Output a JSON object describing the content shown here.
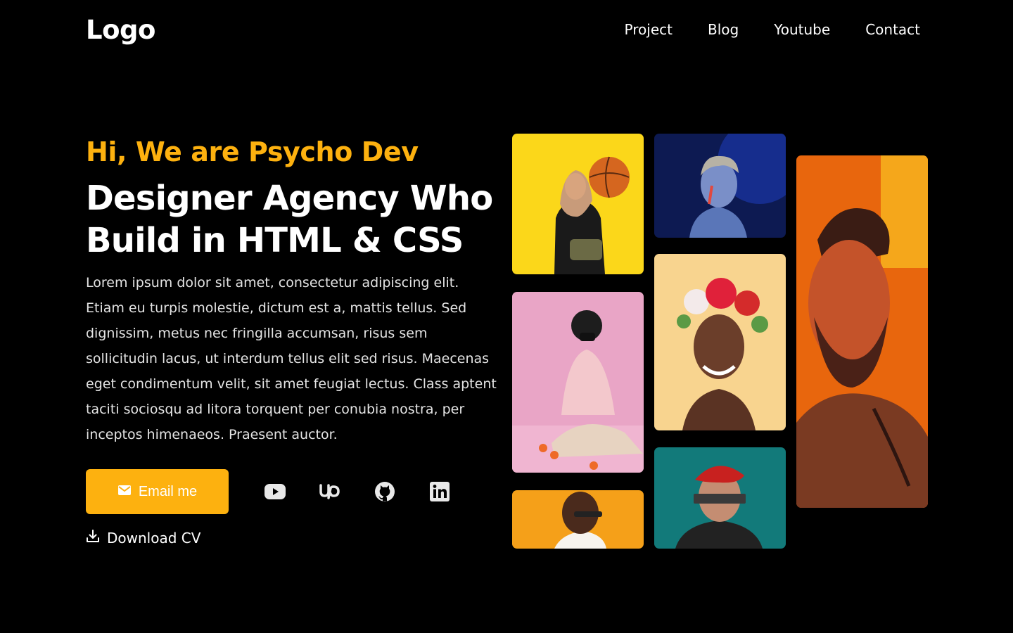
{
  "nav": {
    "logo": "Logo",
    "links": [
      "Project",
      "Blog",
      "Youtube",
      "Contact"
    ]
  },
  "hero": {
    "greeting": "Hi, We are Psycho Dev",
    "headline_line1": "Designer Agency Who",
    "headline_line2": "Build in HTML & CSS",
    "description": "Lorem ipsum dolor sit amet, consectetur adipiscing elit. Etiam eu turpis molestie, dictum est a, mattis tellus. Sed dignissim, metus nec fringilla accumsan, risus sem sollicitudin lacus, ut interdum tellus elit sed risus. Maecenas eget condimentum velit, sit amet feugiat lectus. Class aptent taciti sociosqu ad litora torquent per conubia nostra, per inceptos himenaeos. Praesent auctor."
  },
  "actions": {
    "email_label": "Email me",
    "download_label": "Download CV"
  },
  "socials": [
    "youtube-icon",
    "upwork-icon",
    "github-icon",
    "linkedin-icon"
  ],
  "colors": {
    "accent": "#fdb10f",
    "background": "#000000",
    "text": "#ffffff"
  }
}
